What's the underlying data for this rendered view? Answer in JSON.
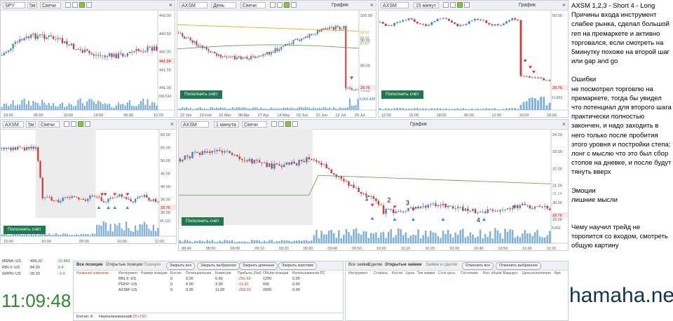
{
  "charts": {
    "spy": {
      "symbol": "SPY",
      "interval": "5м",
      "type": "Свечи",
      "y_ticks": [
        "443.00",
        "442.50",
        "442.00",
        "441.50",
        "441.00"
      ],
      "last_price": "441.84",
      "x_ticks": [
        "19:00",
        "06:00",
        "12:00",
        "19:00",
        "06:00",
        "12:00"
      ],
      "volume_label": "308,534"
    },
    "axsm_daily": {
      "symbol": "AXSM",
      "interval": "День",
      "type": "Свечи",
      "title": "График",
      "y_ticks": [
        "100.00",
        "90.00",
        "80.00",
        "70.00"
      ],
      "ma_labels": [
        "98.52",
        "88.52",
        "87.87"
      ],
      "last_price": "29.76",
      "x_ticks": [
        "22 Jan",
        "10 Feb",
        "02 Mar",
        "08 Apr",
        "27 Apr",
        "14 May",
        "03 Jun",
        "22 Jun",
        "12 Jul",
        "29 Jul"
      ],
      "volume_label": "5,003,408",
      "order_button": "Пополнить счёт"
    },
    "axsm_15m": {
      "symbol": "AXSM",
      "interval": "15 минут",
      "title": "График",
      "y_ticks": [
        "50.00",
        "40.00"
      ],
      "last_price": "29.76",
      "x_ticks": [
        "12:00",
        "15:00",
        "18:00",
        "06:00",
        "12:00",
        "15:00",
        "18:00"
      ],
      "volume_label": "41,852",
      "order_button": "Пополнить счёт"
    },
    "axsm_5m": {
      "symbol": "AXSM",
      "interval": "5м",
      "type": "Свечи",
      "y_ticks": [
        "60.00",
        "55.00",
        "50.00",
        "45.00",
        "40.00",
        "35.00",
        "30.00"
      ],
      "last_price": "29.76",
      "x_ticks": [
        "15:00",
        "16:00",
        "09:00",
        "10:00",
        "11:00"
      ],
      "volume_label": "40,118",
      "order_button": "Пополнить счёт"
    },
    "axsm_1m": {
      "symbol": "AXSM",
      "interval": "1 минута",
      "type": "Свечи",
      "title": "График",
      "y_ticks": [
        "34.00",
        "33.00",
        "32.00",
        "31.00",
        "30.00",
        "29.00"
      ],
      "ma_label": "31.04",
      "last_price": "29.76",
      "x_ticks": [
        "08:40",
        "08:50",
        "09:00",
        "09:10",
        "09:20",
        "09:30",
        "09:40",
        "09:50",
        "10:00",
        "10:10",
        "10:20",
        "10:30",
        "10:40",
        "10:50",
        "11:00",
        "11:10"
      ],
      "volume_label": "5,802",
      "order_button": "Пополнить счёт",
      "annotations": [
        "1",
        "2",
        "3",
        "4"
      ]
    }
  },
  "watchlist": [
    {
      "symbol": "MRNA~US",
      "price": "499.33",
      "change": "23.480"
    },
    {
      "symbol": "RBLX~US",
      "price": "84.30",
      "change": "8.4"
    },
    {
      "symbol": "GRPN~US",
      "price": "28.33",
      "change": "-2.4"
    }
  ],
  "clock": "11:09:48",
  "positions": {
    "tabs": [
      "Все позиции",
      "Открытые позиции"
    ],
    "title": "Позиции",
    "buttons": [
      "Закрыть все",
      "Закрыть выбранное",
      "Закрыть длинные",
      "Закрыть короткие"
    ],
    "columns": [
      "Название компании",
      "Инструмент",
      "Размер позиции",
      "Кол-во",
      "Потенциальная",
      "Комиссии",
      "Прибыль (Net)",
      "Объём позиции",
      "Использованная ПС"
    ],
    "rows": [
      {
        "instrument": "RBLX~US",
        "size": "0",
        "potential": "0.00",
        "fees": "6.60",
        "pnl": "-256.60",
        "volume": "1200",
        "used": "0.00"
      },
      {
        "instrument": "PGNY~US",
        "size": "0",
        "potential": "0.00",
        "fees": "3.30",
        "pnl": "-13.30",
        "volume": "600",
        "used": "0.00"
      },
      {
        "instrument": "AXSM~US",
        "size": "0",
        "potential": "0.00",
        "fees": "11.00",
        "pnl": "-268.00",
        "volume": "2000",
        "used": "0.00"
      }
    ],
    "footer_count_label": "Кол-во:",
    "footer_count": "8",
    "footer_unrealized_label": "Нереализованная:",
    "footer_unrealized": "0.00 USD"
  },
  "orders": {
    "tabs": [
      "Все заявки",
      "Сделки",
      "Открытые заявки"
    ],
    "title": "Заявки и сделки",
    "buttons": [
      "Отменить все",
      "Отменить выбранное"
    ],
    "columns": [
      "Инструмент",
      "Сторона",
      "Кол-во",
      "Цена",
      "Тип заявки",
      "Стоп цена",
      "Состояние",
      "Исп. объём",
      "Маршрут",
      "Цена исполнения",
      "Вре"
    ]
  },
  "notes": {
    "title": "AXSM 1,2,3 - Short 4 - Long",
    "reasons": "Причины входа инструмент слабее рынка, сделал большой геп на премаркете и активно торговался, если смотреть на 5минутку похоже на второй шаг или gap and go",
    "errors_title": "Ошибки",
    "errors": "не посмотрел торговлю на премаркете, тогда бы увидел что потенциал для второго шага практически полностью закончен, и надо заходить в него только после пробития этого уровня и постройки степа;  лонг с мыслю что это был сбор стопов на дневке, и после будут тянуть вверх",
    "emotions_title": "Эмоции",
    "emotions": "лишние мысли",
    "lesson": "Чему научил трейд не торопится со входом, смотреть общую картину"
  },
  "watermark": "hamaha.net",
  "colors": {
    "up": "#3a86c8",
    "down": "#d23a3a",
    "ma": "#6aa84f",
    "ma2": "#e0b020",
    "accent": "#1e7a4e",
    "clock": "#2e8b2e"
  }
}
